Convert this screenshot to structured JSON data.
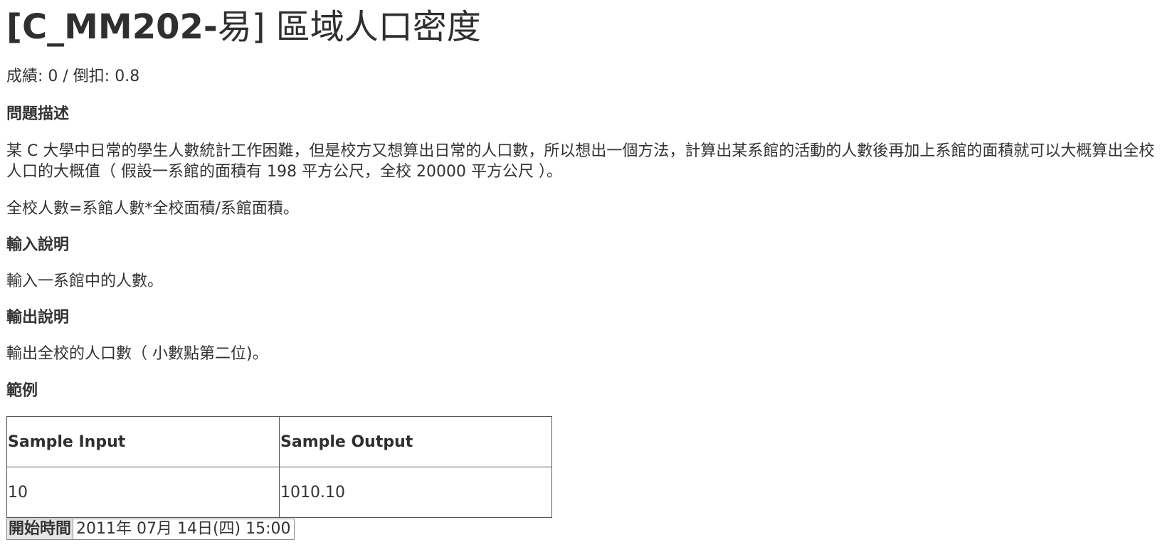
{
  "title": {
    "code": "[C_MM202-",
    "rest": "易] 區域人口密度"
  },
  "score": {
    "text": "成績: 0 / 倒扣: 0.8"
  },
  "sections": {
    "description": {
      "heading": "問題描述",
      "paragraph1": "某 C 大學中日常的學生人數統計工作困難，但是校方又想算出日常的人口數，所以想出一個方法，計算出某系館的活動的人數後再加上系館的面積就可以大概算出全校人口的大概值（ 假設一系館的面積有 198 平方公尺，全校 20000 平方公尺 ）。",
      "paragraph2": "全校人數=系館人數*全校面積/系館面積。"
    },
    "input": {
      "heading": "輸入說明",
      "text": "輸入一系館中的人數。"
    },
    "output": {
      "heading": "輸出說明",
      "text": "輸出全校的人口數（ 小數點第二位)。"
    },
    "example": {
      "heading": "範例"
    }
  },
  "sample_table": {
    "headers": [
      "Sample Input",
      "Sample Output"
    ],
    "rows": [
      [
        "10",
        "1010.10"
      ]
    ]
  },
  "start_time": {
    "label": "開始時間",
    "value": "2011年 07月 14日(四) 15:00"
  }
}
